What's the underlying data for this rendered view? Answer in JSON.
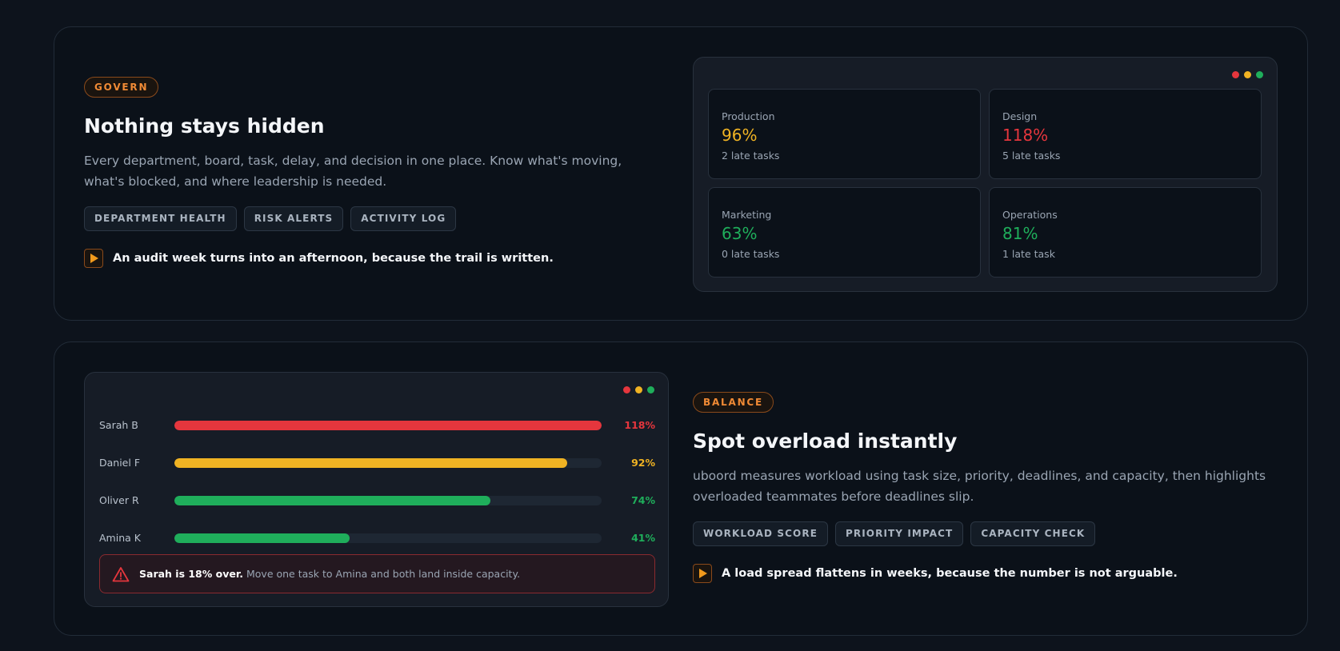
{
  "govern": {
    "pill": "GOVERN",
    "headline": "Nothing stays hidden",
    "description": "Every department, board, task, delay, and decision in one place. Know what's moving, what's blocked, and where leadership is needed.",
    "tags": [
      "DEPARTMENT HEALTH",
      "RISK ALERTS",
      "ACTIVITY LOG"
    ],
    "note": "An audit week turns into an afternoon, because the trail is written.",
    "departments": [
      {
        "name": "Production",
        "pct": "96%",
        "late": "2 late tasks",
        "color": "#f0b323"
      },
      {
        "name": "Design",
        "pct": "118%",
        "late": "5 late tasks",
        "color": "#e5363d"
      },
      {
        "name": "Marketing",
        "pct": "63%",
        "late": "0 late tasks",
        "color": "#1fae5b"
      },
      {
        "name": "Operations",
        "pct": "81%",
        "late": "1 late task",
        "color": "#1fae5b"
      }
    ]
  },
  "balance": {
    "pill": "BALANCE",
    "headline": "Spot overload instantly",
    "description": "uboord measures workload using task size, priority, deadlines, and capacity, then highlights overloaded teammates before deadlines slip.",
    "tags": [
      "WORKLOAD SCORE",
      "PRIORITY IMPACT",
      "CAPACITY CHECK"
    ],
    "note": "A load spread flattens in weeks, because the number is not arguable.",
    "people": [
      {
        "name": "Sarah B",
        "value": 1.0,
        "label": "118%",
        "color": "#e5363d"
      },
      {
        "name": "Daniel F",
        "value": 0.92,
        "label": "92%",
        "color": "#f0b323"
      },
      {
        "name": "Oliver R",
        "value": 0.74,
        "label": "74%",
        "color": "#1fae5b"
      },
      {
        "name": "Amina K",
        "value": 0.41,
        "label": "41%",
        "color": "#1fae5b"
      }
    ],
    "alert": {
      "bold": "Sarah is 18% over.",
      "text": "Move one task to Amina and both land inside capacity."
    }
  },
  "window_dots": [
    "#e5363d",
    "#f0b323",
    "#1fae5b"
  ]
}
